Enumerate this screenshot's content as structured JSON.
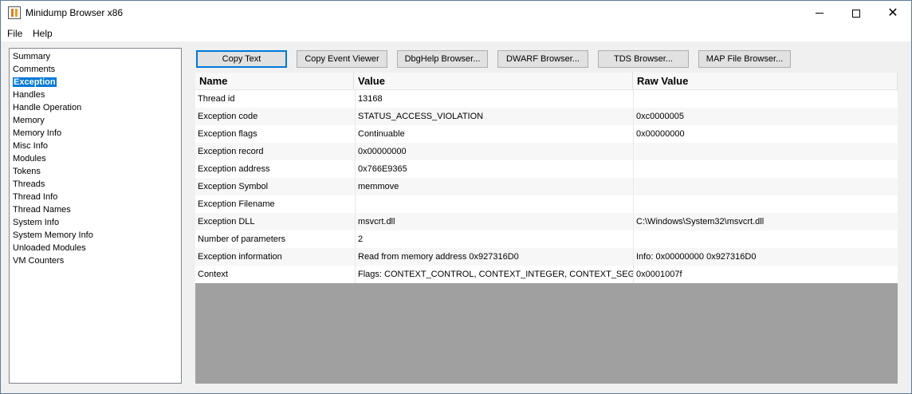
{
  "window": {
    "title": "Minidump Browser x86",
    "minimize_glyph": "",
    "close_glyph": "✕"
  },
  "menu": {
    "file": "File",
    "help": "Help"
  },
  "sidebar": {
    "items": [
      {
        "label": "Summary"
      },
      {
        "label": "Comments"
      },
      {
        "label": "Exception",
        "selected": true
      },
      {
        "label": "Handles"
      },
      {
        "label": "Handle Operation"
      },
      {
        "label": "Memory"
      },
      {
        "label": "Memory Info"
      },
      {
        "label": "Misc Info"
      },
      {
        "label": "Modules"
      },
      {
        "label": "Tokens"
      },
      {
        "label": "Threads"
      },
      {
        "label": "Thread Info"
      },
      {
        "label": "Thread Names"
      },
      {
        "label": "System Info"
      },
      {
        "label": "System Memory Info"
      },
      {
        "label": "Unloaded Modules"
      },
      {
        "label": "VM Counters"
      }
    ]
  },
  "toolbar": {
    "copy_text": "Copy Text",
    "copy_event_viewer": "Copy Event Viewer",
    "dbghelp_browser": "DbgHelp Browser...",
    "dwarf_browser": "DWARF Browser...",
    "tds_browser": "TDS Browser...",
    "map_file_browser": "MAP File Browser..."
  },
  "grid": {
    "columns": [
      "Name",
      "Value",
      "Raw Value"
    ],
    "rows": [
      [
        "Thread id",
        "13168",
        ""
      ],
      [
        "Exception code",
        "STATUS_ACCESS_VIOLATION",
        "0xc0000005"
      ],
      [
        "Exception flags",
        "Continuable",
        "0x00000000"
      ],
      [
        "Exception record",
        "0x00000000",
        ""
      ],
      [
        "Exception address",
        "0x766E9365",
        ""
      ],
      [
        "Exception Symbol",
        "memmove",
        ""
      ],
      [
        "Exception Filename",
        "",
        ""
      ],
      [
        "Exception DLL",
        "msvcrt.dll",
        "C:\\Windows\\System32\\msvcrt.dll"
      ],
      [
        "Number of parameters",
        "2",
        ""
      ],
      [
        "Exception information",
        "Read from memory address 0x927316D0",
        "Info: 0x00000000 0x927316D0"
      ],
      [
        "Context",
        "Flags: CONTEXT_CONTROL, CONTEXT_INTEGER, CONTEXT_SEGMEN",
        "0x0001007f"
      ]
    ]
  },
  "colors": {
    "selection": "#0078d7",
    "grid_empty": "#a0a0a0"
  }
}
